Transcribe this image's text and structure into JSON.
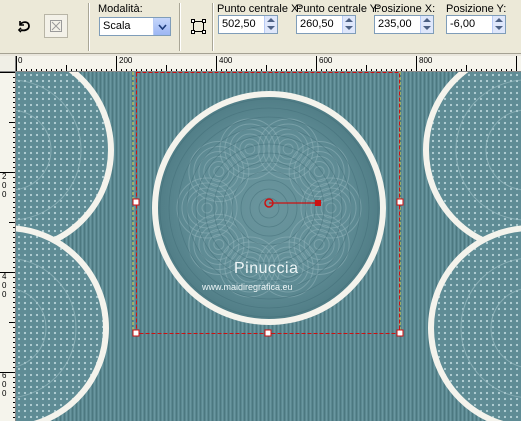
{
  "toolbar": {
    "mode_label": "Modalità:",
    "mode_value": "Scala",
    "center_x_label": "Punto centrale X:",
    "center_x_value": "502,50",
    "center_y_label": "Punto centrale Y:",
    "center_y_value": "260,50",
    "pos_x_label": "Posizione X:",
    "pos_x_value": "235,00",
    "pos_y_label": "Posizione Y:",
    "pos_y_value": "-6,00",
    "icons": {
      "reset": "undo-arrow-icon",
      "pick": "pick-tool-icon",
      "dropdown": "chevron-down-icon",
      "frame": "frame-icon"
    }
  },
  "ruler": {
    "h_labels": [
      "0",
      "200",
      "400",
      "600",
      "800"
    ],
    "v_labels": [
      [
        "2",
        "0",
        "0"
      ],
      [
        "4",
        "0",
        "0"
      ],
      [
        "6",
        "0",
        "0"
      ]
    ]
  },
  "canvas": {
    "background": "#5d8a93",
    "circle_border": "#f4f3ec",
    "selection_color": "#cc1111",
    "guide_color": "#e8e04a"
  },
  "watermark": {
    "name": "Pinuccia",
    "url": "www.maidiregrafica.eu"
  }
}
